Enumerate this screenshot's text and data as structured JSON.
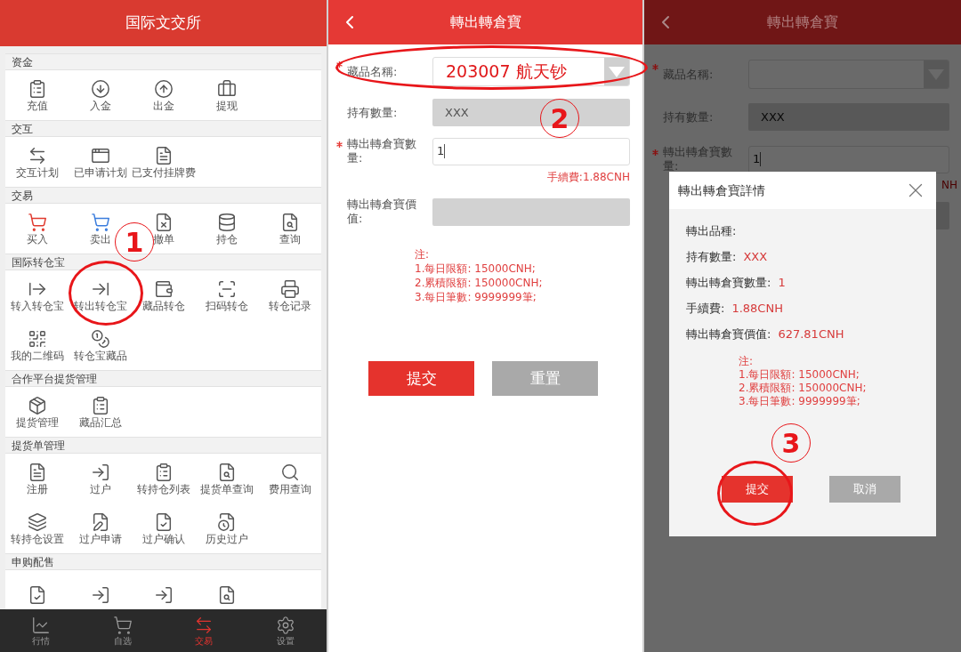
{
  "menu_screen": {
    "title": "国际文交所",
    "sections": [
      {
        "title": "资金",
        "items": [
          {
            "label": "充值"
          },
          {
            "label": "入金"
          },
          {
            "label": "出金"
          },
          {
            "label": "提现"
          }
        ]
      },
      {
        "title": "交互",
        "items": [
          {
            "label": "交互计划"
          },
          {
            "label": "已申请计划"
          },
          {
            "label": "已支付挂牌费"
          }
        ]
      },
      {
        "title": "交易",
        "items": [
          {
            "label": "买入"
          },
          {
            "label": "卖出"
          },
          {
            "label": "撤单"
          },
          {
            "label": "持仓"
          },
          {
            "label": "查询"
          }
        ]
      },
      {
        "title": "国际转仓宝",
        "items": [
          {
            "label": "转入转仓宝"
          },
          {
            "label": "转出转仓宝"
          },
          {
            "label": "藏品转仓"
          },
          {
            "label": "扫码转仓"
          },
          {
            "label": "转仓记录"
          },
          {
            "label": "我的二维码"
          },
          {
            "label": "转仓宝藏品"
          }
        ]
      },
      {
        "title": "合作平台提货管理",
        "items": [
          {
            "label": "提货管理"
          },
          {
            "label": "藏品汇总"
          }
        ]
      },
      {
        "title": "提货单管理",
        "items": [
          {
            "label": "注册"
          },
          {
            "label": "过户"
          },
          {
            "label": "转持仓列表"
          },
          {
            "label": "提货单查询"
          },
          {
            "label": "费用查询"
          },
          {
            "label": "转持仓设置"
          },
          {
            "label": "过户申请"
          },
          {
            "label": "过户确认"
          },
          {
            "label": "历史过户"
          }
        ]
      },
      {
        "title": "申购配售",
        "items": [
          {
            "kind": "icon"
          },
          {
            "kind": "icon"
          },
          {
            "kind": "icon"
          },
          {
            "kind": "icon"
          }
        ]
      }
    ],
    "tabs": [
      {
        "label": "行情",
        "selected": false
      },
      {
        "label": "自选",
        "selected": false
      },
      {
        "label": "交易",
        "selected": true
      },
      {
        "label": "设置",
        "selected": false
      }
    ]
  },
  "form_screen": {
    "title": "轉出轉倉寶",
    "fields": [
      {
        "kind": "select",
        "label": "藏品名稱:",
        "required": true,
        "value": "203007 航天钞"
      },
      {
        "kind": "readonly",
        "label": "持有數量:",
        "required": false,
        "value": "XXX"
      },
      {
        "kind": "input",
        "label": "轉出轉倉寶數量:",
        "required": true,
        "value": "1"
      },
      {
        "kind": "readonly",
        "label": "轉出轉倉寶價值:",
        "required": false
      }
    ],
    "fee": "手續費:1.88CNH",
    "notes": [
      "注:",
      "1.每日限額: 15000CNH;",
      "2.累積限額: 150000CNH;",
      "3.每日筆數: 9999999筆;"
    ],
    "buttons": [
      {
        "kind": "primary",
        "label": "提交"
      },
      {
        "kind": "secondary",
        "label": "重置"
      }
    ]
  },
  "confirm_screen": {
    "title": "轉出轉倉寶",
    "fields": [
      {
        "kind": "select",
        "label": "藏品名稱:",
        "required": true
      },
      {
        "kind": "readonly",
        "label": "持有數量:",
        "required": false,
        "value": "XXX"
      },
      {
        "kind": "input",
        "label": "轉出轉倉寶數量:",
        "required": true,
        "value": "1"
      }
    ],
    "fee": "NH",
    "dialog": {
      "title": "轉出轉倉寶詳情",
      "rows": [
        {
          "label": "轉出品種:"
        },
        {
          "label": "持有數量:",
          "value": "XXX"
        },
        {
          "label": "轉出轉倉寶數量:",
          "value": "1"
        },
        {
          "label": "手續費:",
          "value": "1.88CNH"
        },
        {
          "label": "轉出轉倉寶價值:",
          "value": "627.81CNH"
        }
      ],
      "notes": [
        "注:",
        "1.每日限額: 15000CNH;",
        "2.累積限額: 150000CNH;",
        "3.每日筆數: 9999999筆;"
      ],
      "buttons": [
        {
          "kind": "primary",
          "label": "提交"
        },
        {
          "kind": "secondary",
          "label": "取消"
        }
      ]
    }
  },
  "annotations": [
    {
      "label": "1"
    },
    {
      "label": "2"
    },
    {
      "label": "3"
    }
  ]
}
